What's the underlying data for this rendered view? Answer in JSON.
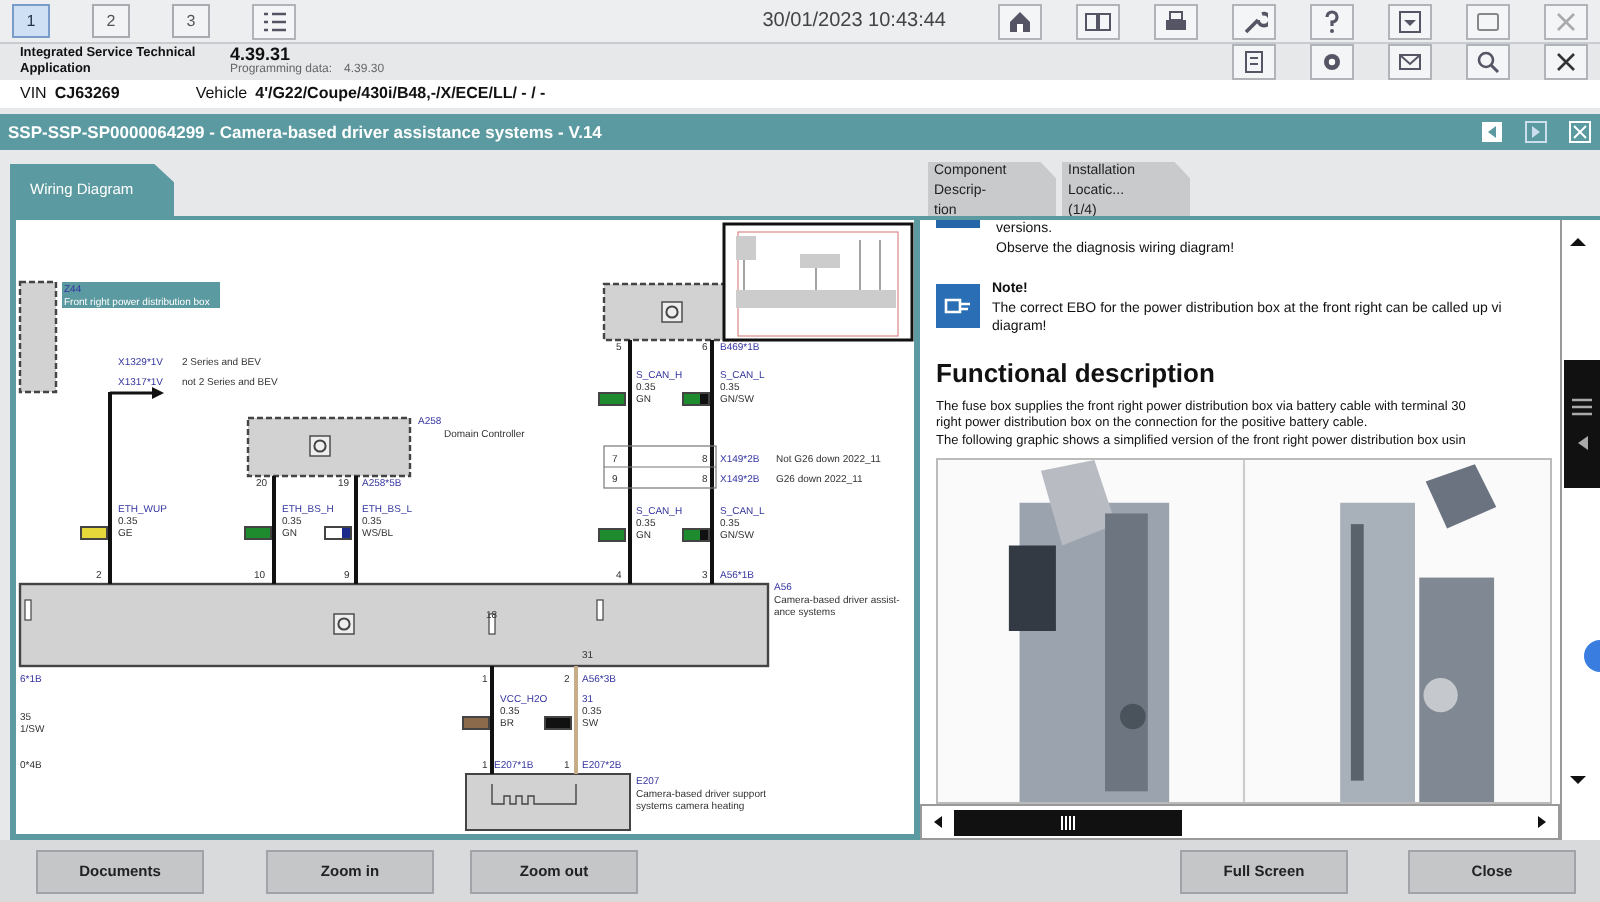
{
  "toolbar": {
    "tabs": [
      {
        "label": "1",
        "selected": true
      },
      {
        "label": "2",
        "selected": false
      },
      {
        "label": "3",
        "selected": false
      }
    ],
    "datetime": "30/01/2023 10:43:44"
  },
  "app": {
    "name_lines": [
      "Integrated Service Technical",
      "Application"
    ],
    "version": "4.39.31",
    "programming_label": "Programming data:",
    "programming_version": "4.39.30"
  },
  "vehicle_bar": {
    "vin_label": "VIN",
    "vin": "CJ63269",
    "vehicle_label": "Vehicle",
    "vehicle": "4'/G22/Coupe/430i/B48,-/X/ECE/LL/ - / -"
  },
  "document_title": "SSP-SSP-SP0000064299 - Camera-based driver assistance systems - V.14",
  "left_tabs": [
    {
      "label": "Wiring Diagram",
      "selected": true
    }
  ],
  "diagram": {
    "labels": [
      {
        "text": "Z44",
        "kind": "code"
      },
      {
        "text": "Front right power distribution box",
        "kind": "caption"
      },
      {
        "text": "X1329*1V",
        "kind": "connector"
      },
      {
        "text": "2 Series and BEV",
        "kind": "plain"
      },
      {
        "text": "X1317*1V",
        "kind": "code"
      },
      {
        "text": "not 2 Series and BEV",
        "kind": "plain"
      },
      {
        "text": "A258",
        "kind": "code"
      },
      {
        "text": "Domain Controller",
        "kind": "plain"
      },
      {
        "text": "20",
        "kind": "pin"
      },
      {
        "text": "19",
        "kind": "pin"
      },
      {
        "text": "A258*5B",
        "kind": "code"
      },
      {
        "text": "2",
        "kind": "pin"
      },
      {
        "text": "10",
        "kind": "pin"
      },
      {
        "text": "9",
        "kind": "pin"
      },
      {
        "text": "5",
        "kind": "pin"
      },
      {
        "text": "6",
        "kind": "pin"
      },
      {
        "text": "B469*1B",
        "kind": "code"
      },
      {
        "text": "7",
        "kind": "pin"
      },
      {
        "text": "8",
        "kind": "pin"
      },
      {
        "text": "X149*2B",
        "kind": "code"
      },
      {
        "text": "Not G26 down 2022_11",
        "kind": "plain"
      },
      {
        "text": "9",
        "kind": "pin"
      },
      {
        "text": "8",
        "kind": "pin"
      },
      {
        "text": "X149*2B",
        "kind": "code"
      },
      {
        "text": "G26 down 2022_11",
        "kind": "plain"
      },
      {
        "text": "4",
        "kind": "pin"
      },
      {
        "text": "3",
        "kind": "pin"
      },
      {
        "text": "A56*1B",
        "kind": "code"
      },
      {
        "text": "A56",
        "kind": "code"
      },
      {
        "text": "Camera-based driver assist-",
        "kind": "plain"
      },
      {
        "text": "ance systems",
        "kind": "plain"
      },
      {
        "text": "6*1B",
        "kind": "code"
      },
      {
        "text": "35",
        "kind": "plain"
      },
      {
        "text": "1/SW",
        "kind": "plain"
      },
      {
        "text": "0*4B",
        "kind": "plain"
      },
      {
        "text": "18",
        "kind": "pin"
      },
      {
        "text": "31",
        "kind": "pin"
      },
      {
        "text": "1",
        "kind": "pin"
      },
      {
        "text": "2",
        "kind": "pin"
      },
      {
        "text": "A56*3B",
        "kind": "code"
      },
      {
        "text": "1",
        "kind": "pin"
      },
      {
        "text": "E207*1B",
        "kind": "code"
      },
      {
        "text": "1",
        "kind": "pin"
      },
      {
        "text": "E207*2B",
        "kind": "code"
      },
      {
        "text": "E207",
        "kind": "code"
      },
      {
        "text": "Camera-based driver support",
        "kind": "plain"
      },
      {
        "text": "systems camera heating",
        "kind": "plain"
      }
    ],
    "wires": [
      {
        "name": "ETH_WUP",
        "size": "0.35",
        "code": "GE",
        "swatch": [
          {
            "color": "#e6d83a"
          }
        ]
      },
      {
        "name": "ETH_BS_H",
        "size": "0.35",
        "code": "GN",
        "swatch": [
          {
            "color": "#1e8c2e"
          }
        ]
      },
      {
        "name": "ETH_BS_L",
        "size": "0.35",
        "code": "WS/BL",
        "swatch": [
          {
            "color": "#ffffff"
          },
          {
            "color": "#1c2a8c"
          }
        ]
      },
      {
        "name": "S_CAN_H",
        "size": "0.35",
        "code": "GN",
        "swatch": [
          {
            "color": "#1e8c2e"
          }
        ]
      },
      {
        "name": "S_CAN_L",
        "size": "0.35",
        "code": "GN/SW",
        "swatch": [
          {
            "color": "#1e8c2e"
          },
          {
            "color": "#111111"
          }
        ]
      },
      {
        "name": "S_CAN_H",
        "size": "0.35",
        "code": "GN",
        "swatch": [
          {
            "color": "#1e8c2e"
          }
        ]
      },
      {
        "name": "S_CAN_L",
        "size": "0.35",
        "code": "GN/SW",
        "swatch": [
          {
            "color": "#1e8c2e"
          },
          {
            "color": "#111111"
          }
        ]
      },
      {
        "name": "VCC_H2O",
        "size": "0.35",
        "code": "BR",
        "swatch": [
          {
            "color": "#8a6a4a"
          }
        ]
      },
      {
        "name": "31",
        "size": "0.35",
        "code": "SW",
        "swatch": [
          {
            "color": "#111111"
          }
        ]
      }
    ]
  },
  "right_tabs": [
    {
      "lines": [
        "Component Descrip-",
        "tion"
      ],
      "selected": false
    },
    {
      "lines": [
        "Installation Locatic...",
        "(1/4)"
      ],
      "selected": false
    }
  ],
  "content": {
    "intro_lines": [
      "versions.",
      "Observe the diagnosis wiring diagram!"
    ],
    "note": {
      "title": "Note!",
      "text": "The correct EBO for the power distribution box at the front right can be called up vi diagram!"
    },
    "heading": "Functional description",
    "paragraph_lines": [
      "The fuse box supplies the front right power distribution box via battery cable with terminal 30",
      "right power distribution box on the connection for the positive battery cable.",
      "The following graphic shows a simplified version of the front right power distribution box usin"
    ],
    "figure": {
      "kind": "picture"
    }
  },
  "buttons": [
    "Documents",
    "Zoom in",
    "Zoom out",
    "Full Screen",
    "Close"
  ]
}
